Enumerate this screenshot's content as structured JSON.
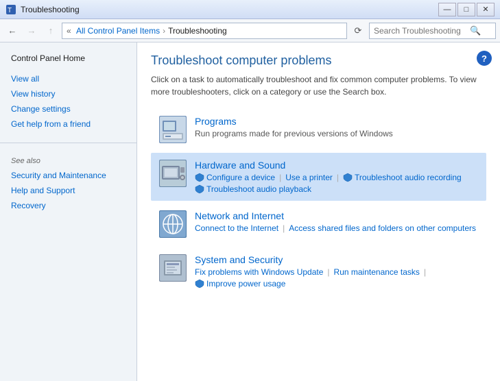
{
  "titlebar": {
    "title": "Troubleshooting",
    "min_btn": "—",
    "max_btn": "□",
    "close_btn": "✕"
  },
  "addressbar": {
    "back_title": "Back",
    "forward_title": "Forward",
    "up_title": "Up",
    "breadcrumb": {
      "root_icon": "«",
      "part1": "All Control Panel Items",
      "sep1": "›",
      "part2": "Troubleshooting"
    },
    "refresh_title": "Refresh",
    "search_placeholder": "Search Troubleshooting",
    "search_icon": "🔍"
  },
  "sidebar": {
    "control_panel_home": "Control Panel Home",
    "view_all": "View all",
    "view_history": "View history",
    "change_settings": "Change settings",
    "get_help": "Get help from a friend",
    "see_also_label": "See also",
    "security": "Security and Maintenance",
    "help_support": "Help and Support",
    "recovery": "Recovery"
  },
  "content": {
    "title": "Troubleshoot computer problems",
    "description": "Click on a task to automatically troubleshoot and fix common computer problems. To view more troubleshooters, click on a category or use the Search box.",
    "help_label": "?",
    "categories": [
      {
        "id": "programs",
        "name": "Programs",
        "desc": "Run programs made for previous versions of Windows",
        "links": [],
        "highlighted": false
      },
      {
        "id": "hardware",
        "name": "Hardware and Sound",
        "desc": "",
        "links": [
          {
            "label": "Configure a device",
            "shield": true
          },
          {
            "label": "Use a printer",
            "shield": false
          },
          {
            "label": "Troubleshoot audio recording",
            "shield": true
          },
          {
            "label": "Troubleshoot audio playback",
            "shield": true
          }
        ],
        "highlighted": true
      },
      {
        "id": "network",
        "name": "Network and Internet",
        "desc": "",
        "links": [
          {
            "label": "Connect to the Internet",
            "shield": false
          },
          {
            "label": "Access shared files and folders on other computers",
            "shield": false
          }
        ],
        "highlighted": false
      },
      {
        "id": "security",
        "name": "System and Security",
        "desc": "",
        "links": [
          {
            "label": "Fix problems with Windows Update",
            "shield": false
          },
          {
            "label": "Run maintenance tasks",
            "shield": false
          },
          {
            "label": "Improve power usage",
            "shield": true
          }
        ],
        "highlighted": false
      }
    ]
  }
}
